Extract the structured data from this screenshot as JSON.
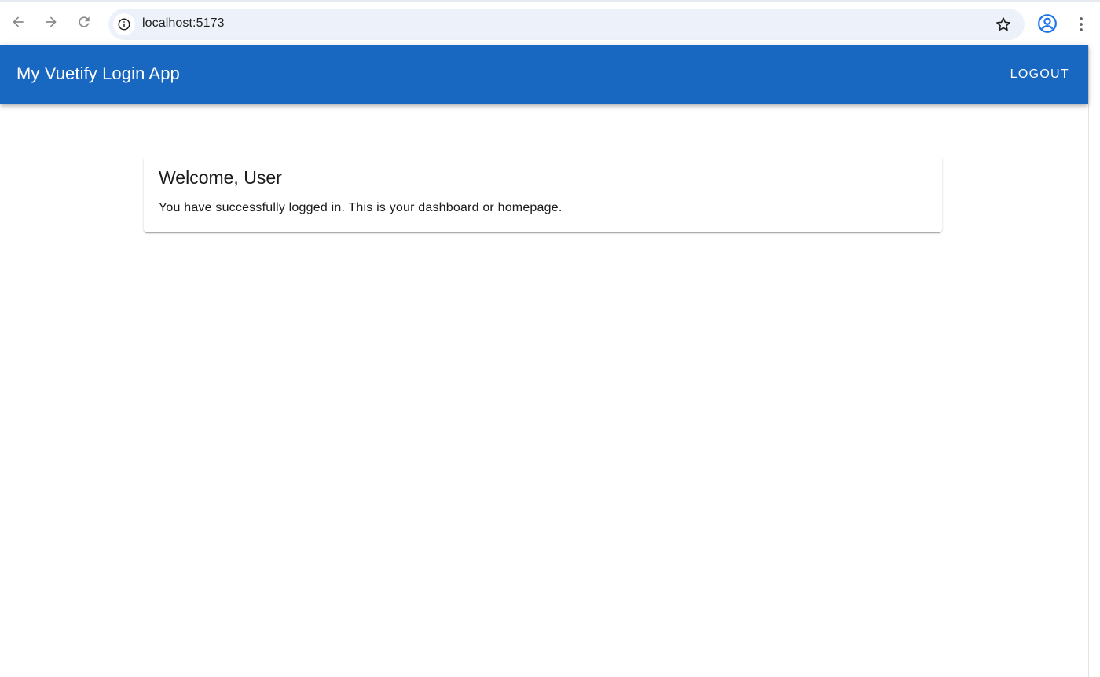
{
  "browser": {
    "url": "localhost:5173",
    "icons": {
      "back": "arrow-left-icon",
      "forward": "arrow-right-icon",
      "reload": "reload-icon",
      "site_info": "info-icon",
      "bookmark": "star-icon",
      "profile": "profile-icon",
      "menu": "kebab-menu-icon"
    }
  },
  "app_bar": {
    "title": "My Vuetify Login App",
    "logout_label": "Logout",
    "color": "#1867c0"
  },
  "card": {
    "title": "Welcome, User",
    "text": "You have successfully logged in. This is your dashboard or homepage."
  }
}
